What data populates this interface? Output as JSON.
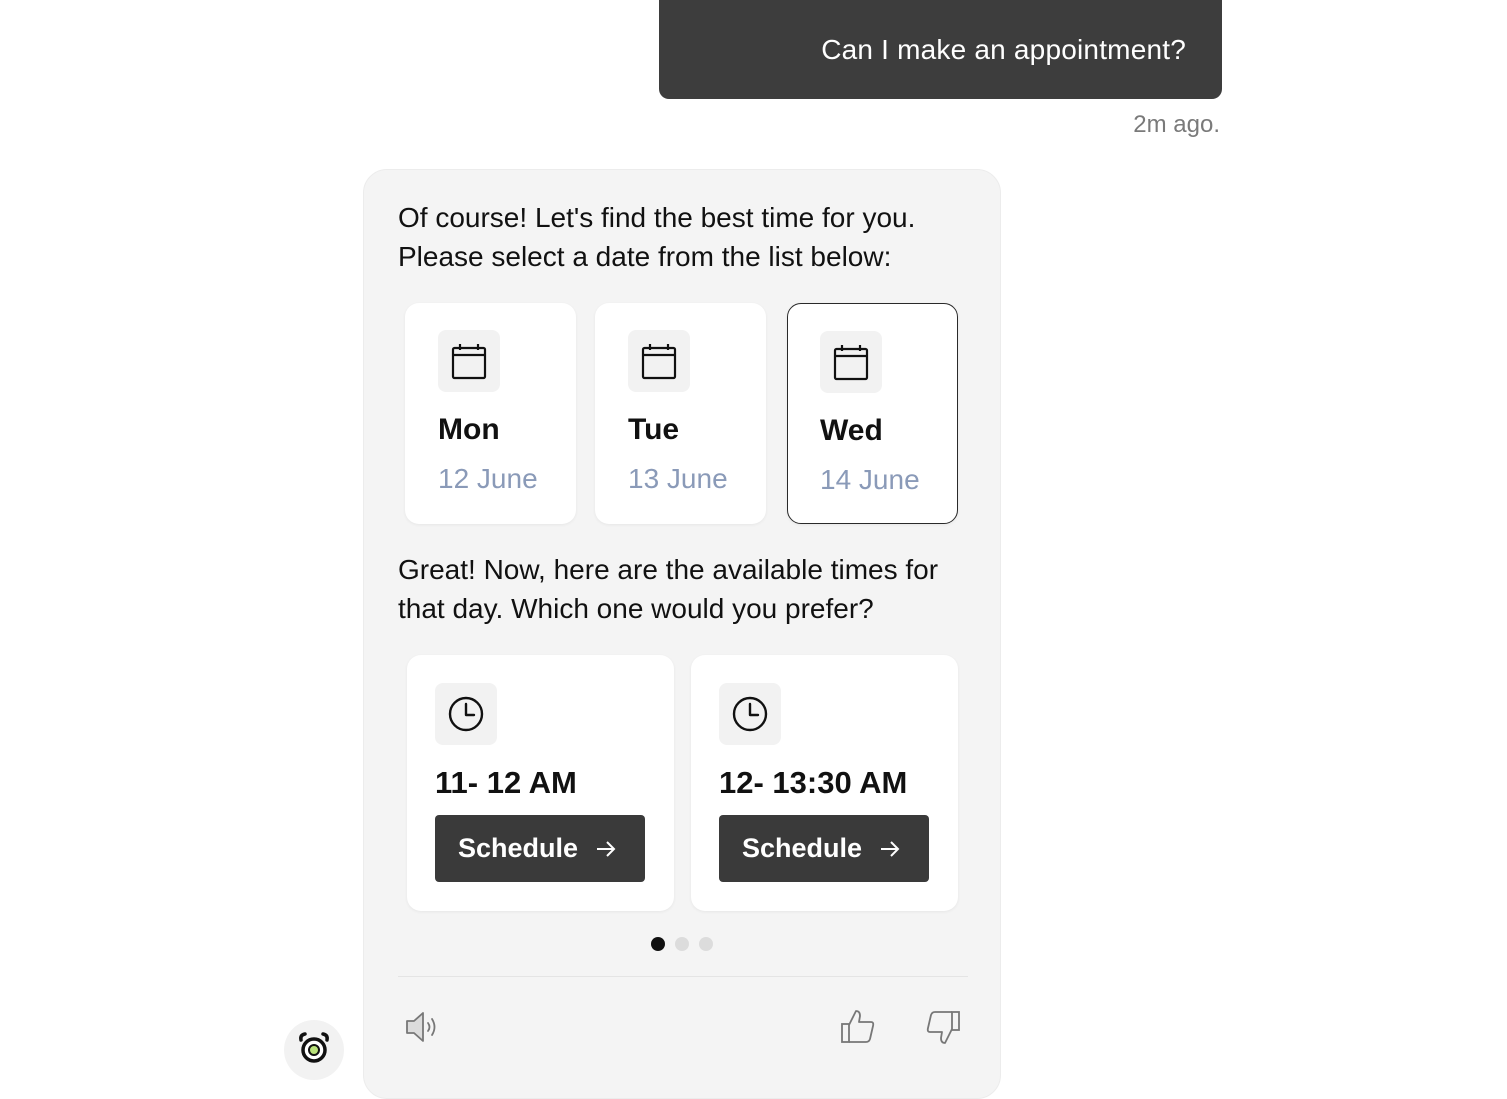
{
  "user_message": {
    "text": "Can I make an appointment?",
    "timestamp": "2m ago."
  },
  "bot": {
    "intro_text": "Of course! Let's find the best time for you. Please select a date from the list below:",
    "dates": [
      {
        "day": "Mon",
        "date": "12 June",
        "icon": "calendar-icon",
        "selected": false
      },
      {
        "day": "Tue",
        "date": "13 June",
        "icon": "calendar-icon",
        "selected": false
      },
      {
        "day": "Wed",
        "date": "14 June",
        "icon": "calendar-icon",
        "selected": true
      }
    ],
    "followup_text": "Great! Now, here are the available times for that day. Which one would you prefer?",
    "times": [
      {
        "time": "11- 12 AM",
        "button": "Schedule",
        "icon": "clock-icon"
      },
      {
        "time": "12- 13:30 AM",
        "button": "Schedule",
        "icon": "clock-icon"
      }
    ],
    "carousel": {
      "pages": 3,
      "active_index": 0
    },
    "footer_icons": [
      "speaker-icon",
      "thumbs-up-icon",
      "thumbs-down-icon"
    ]
  },
  "avatar_icon": "alarm-clock-icon",
  "colors": {
    "user_bubble": "#3d3d3d",
    "card_bg": "#f4f4f4",
    "button_bg": "#3a3a3a",
    "date_text": "#8a9ab8",
    "timestamp_text": "#7a7a7a"
  }
}
